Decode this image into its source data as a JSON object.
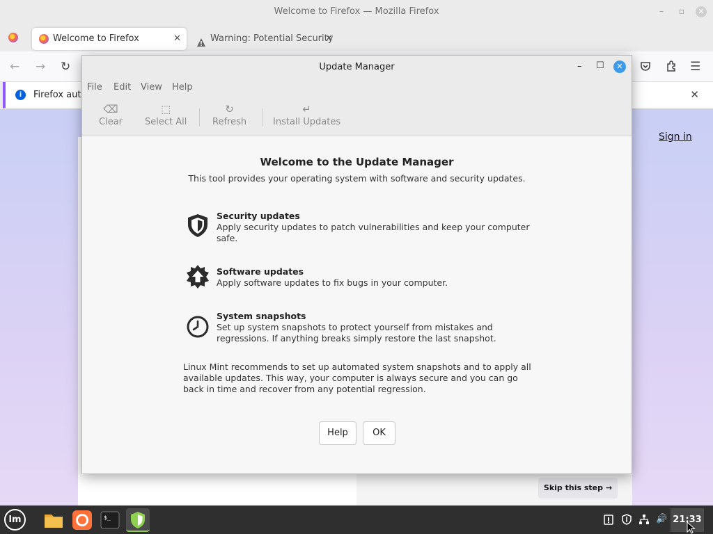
{
  "firefox": {
    "window_title": "Welcome to Firefox — Mozilla Firefox",
    "tabs": [
      {
        "label": "Welcome to Firefox",
        "active": true
      },
      {
        "label": "Warning: Potential Security",
        "active": false
      }
    ],
    "notification_text": "Firefox auto",
    "sign_in": "Sign in",
    "skip_step": "Skip this step →"
  },
  "update_manager": {
    "title": "Update Manager",
    "menu": [
      "File",
      "Edit",
      "View",
      "Help"
    ],
    "toolbar": {
      "clear": "Clear",
      "select_all": "Select All",
      "refresh": "Refresh",
      "install_updates": "Install Updates"
    },
    "welcome": {
      "title": "Welcome to the Update Manager",
      "subtitle": "This tool provides your operating system with software and security updates.",
      "features": [
        {
          "title": "Security updates",
          "description": "Apply security updates to patch vulnerabilities and keep your computer safe.",
          "icon": "shield-icon"
        },
        {
          "title": "Software updates",
          "description": "Apply software updates to fix bugs in your computer.",
          "icon": "upgrade-star-icon"
        },
        {
          "title": "System snapshots",
          "description": "Set up system snapshots to protect yourself from mistakes and regressions. If anything breaks simply restore the last snapshot.",
          "icon": "clock-icon"
        }
      ],
      "recommendation": "Linux Mint recommends to set up automated system snapshots and to apply all available updates. This way, your computer is always secure and you can go back in time and recover from any potential regression.",
      "help_button": "Help",
      "ok_button": "OK"
    }
  },
  "taskbar": {
    "clock": "21:33",
    "apps": [
      "files",
      "firefox",
      "terminal",
      "update-manager"
    ]
  },
  "colors": {
    "accent_blue": "#3d9ae8",
    "firefox_purple": "#9059ff",
    "mint_green": "#8fd14f",
    "taskbar": "#2f2f2f"
  }
}
